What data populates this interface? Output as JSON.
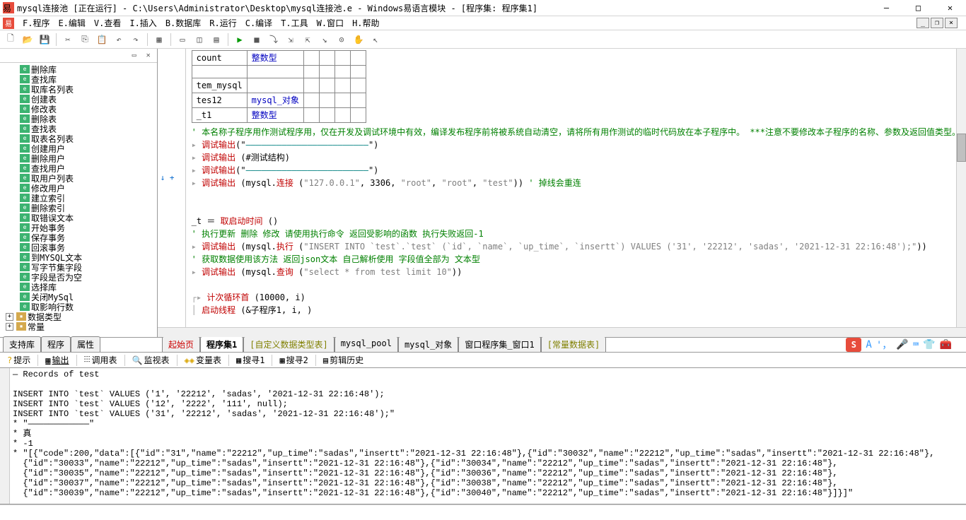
{
  "title": "mysql连接池 [正在运行] - C:\\Users\\Administrator\\Desktop\\mysql连接池.e - Windows易语言模块 - [程序集: 程序集1]",
  "menu": [
    "F.程序",
    "E.编辑",
    "V.查看",
    "I.插入",
    "B.数据库",
    "R.运行",
    "C.编译",
    "T.工具",
    "W.窗口",
    "H.帮助"
  ],
  "tree": {
    "items": [
      "删除库",
      "查找库",
      "取库名列表",
      "创建表",
      "修改表",
      "删除表",
      "查找表",
      "取表名列表",
      "创建用户",
      "删除用户",
      "查找用户",
      "取用户列表",
      "修改用户",
      "建立索引",
      "删除索引",
      "取错误文本",
      "开始事务",
      "保存事务",
      "回滚事务",
      "到MYSQL文本",
      "写字节集字段",
      "字段是否为空",
      "选择库",
      "关闭MySql",
      "取影响行数"
    ],
    "folders": [
      "数据类型",
      "常量"
    ]
  },
  "vartable": [
    {
      "name": "count",
      "type": "整数型"
    },
    {
      "name": "",
      "type": ""
    },
    {
      "name": "tem_mysql",
      "type": ""
    },
    {
      "name": "tes12",
      "type": "mysql_对象"
    },
    {
      "name": "_t1",
      "type": "整数型"
    }
  ],
  "code": {
    "comment1": "' 本名称子程序用作测试程序用，仅在开发及调试环境中有效，编译发布程序前将被系统自动清空，请将所有用作测试的临时代码放在本子程序中。 ***注意不要修改本子程序的名称、参数及返回值类型。",
    "l1_a": "调试输出",
    "l1_b": "(\"",
    "l1_c": "————————————————————————",
    "l1_d": "\")",
    "l2_a": "调试输出",
    "l2_b": " (#测试结构)",
    "l3_a": "调试输出",
    "l3_b": "(\"",
    "l3_c": "————————————————————————",
    "l3_d": "\")",
    "l4_a": "调试输出",
    "l4_b": " (mysql.",
    "l4_c": "连接",
    "l4_d": " (",
    "l4_e": "\"127.0.0.1\"",
    "l4_f": ", 3306, ",
    "l4_g": "\"root\"",
    "l4_h": ", ",
    "l4_i": "\"root\"",
    "l4_j": ", ",
    "l4_k": "\"test\"",
    "l4_l": "))  ",
    "l4_m": "' 掉线会重连",
    "l5_a": "_t ＝ ",
    "l5_b": "取启动时间",
    "l5_c": " ()",
    "l6": "' 执行更新 删除 修改 请使用执行命令  返回受影响的函数 执行失败返回-1",
    "l7_a": "调试输出",
    "l7_b": " (mysql.",
    "l7_c": "执行",
    "l7_d": " (",
    "l7_e": "\"INSERT INTO `test`.`test` (`id`, `name`, `up_time`, `insertt`) VALUES ('31', '22212', 'sadas', '2021-12-31 22:16:48');\"",
    "l7_f": "))",
    "l8": "' 获取数据使用该方法  返回json文本  自己解析使用  字段值全部为 文本型",
    "l9_a": "调试输出",
    "l9_b": " (mysql.",
    "l9_c": "查询",
    "l9_d": " (",
    "l9_e": "\"select * from test limit 10\"",
    "l9_f": "))",
    "l10_a": "计次循环首",
    "l10_b": " (10000, i)",
    "l11_a": "启动线程",
    "l11_b": " (&子程序1, i, )"
  },
  "left_panels": [
    "支持库",
    "程序",
    "属性"
  ],
  "doc_tabs": [
    "起始页",
    "程序集1",
    "[自定义数据类型表]",
    "mysql_pool",
    "mysql_对象",
    "窗口程序集_窗口1",
    "[常量数据表]"
  ],
  "btm_tabs": [
    "提示",
    "输出",
    "调用表",
    "监视表",
    "变量表",
    "搜寻1",
    "搜寻2",
    "剪辑历史"
  ],
  "output": "— Records of test\n\nINSERT INTO `test` VALUES ('1', '22212', 'sadas', '2021-12-31 22:16:48');\nINSERT INTO `test` VALUES ('12', '2222', '111', null);\nINSERT INTO `test` VALUES ('31', '22212', 'sadas', '2021-12-31 22:16:48');\"\n* \"————————————\"\n* 真\n* -1\n* \"[{\"code\":200,\"data\":[{\"id\":\"31\",\"name\":\"22212\",\"up_time\":\"sadas\",\"insertt\":\"2021-12-31 22:16:48\"},{\"id\":\"30032\",\"name\":\"22212\",\"up_time\":\"sadas\",\"insertt\":\"2021-12-31 22:16:48\"},\n  {\"id\":\"30033\",\"name\":\"22212\",\"up_time\":\"sadas\",\"insertt\":\"2021-12-31 22:16:48\"},{\"id\":\"30034\",\"name\":\"22212\",\"up_time\":\"sadas\",\"insertt\":\"2021-12-31 22:16:48\"},\n  {\"id\":\"30035\",\"name\":\"22212\",\"up_time\":\"sadas\",\"insertt\":\"2021-12-31 22:16:48\"},{\"id\":\"30036\",\"name\":\"22212\",\"up_time\":\"sadas\",\"insertt\":\"2021-12-31 22:16:48\"},\n  {\"id\":\"30037\",\"name\":\"22212\",\"up_time\":\"sadas\",\"insertt\":\"2021-12-31 22:16:48\"},{\"id\":\"30038\",\"name\":\"22212\",\"up_time\":\"sadas\",\"insertt\":\"2021-12-31 22:16:48\"},\n  {\"id\":\"30039\",\"name\":\"22212\",\"up_time\":\"sadas\",\"insertt\":\"2021-12-31 22:16:48\"},{\"id\":\"30040\",\"name\":\"22212\",\"up_time\":\"sadas\",\"insertt\":\"2021-12-31 22:16:48\"}]}]\"",
  "status": ""
}
